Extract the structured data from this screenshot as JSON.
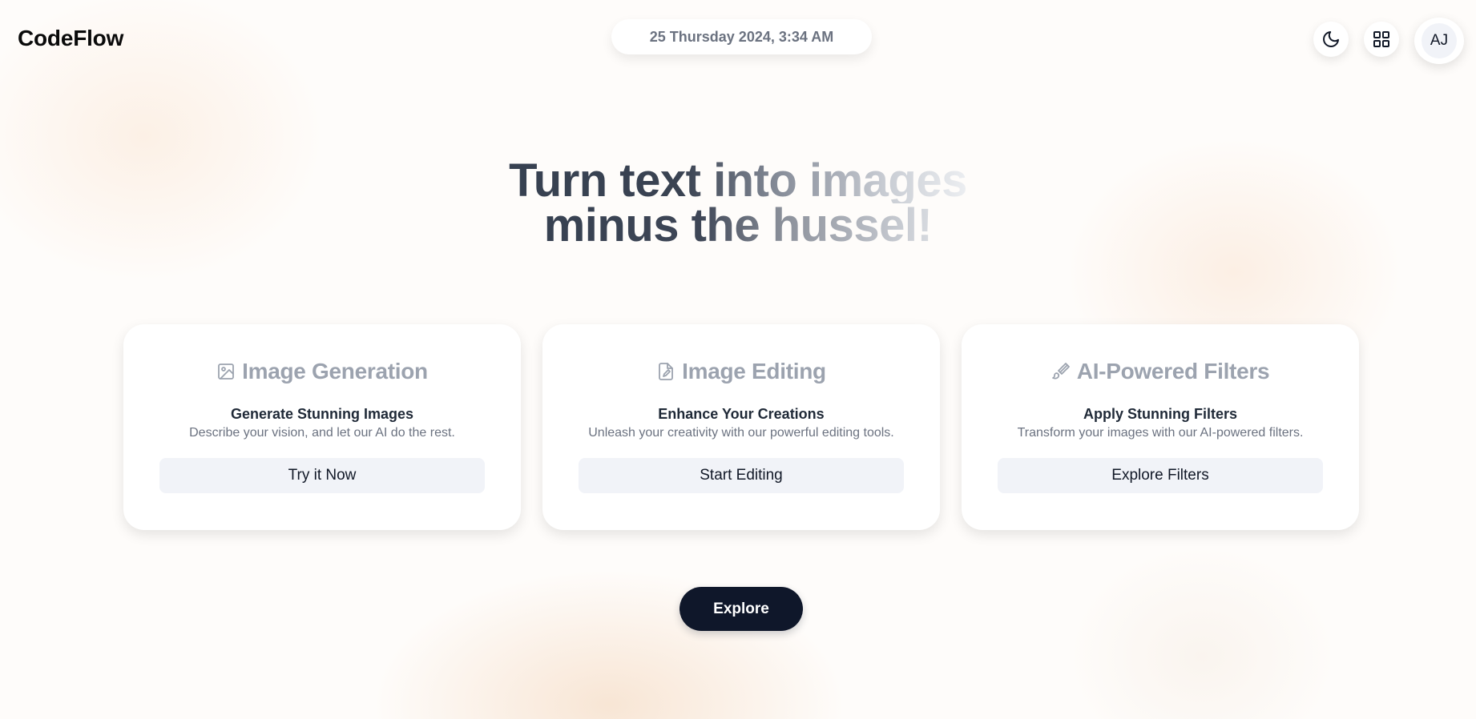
{
  "header": {
    "brand": "CodeFlow",
    "datetime": "25 Thursday 2024, 3:34 AM",
    "avatar_initials": "AJ",
    "icons": {
      "theme": "moon-icon",
      "apps": "grid-icon"
    }
  },
  "hero": {
    "line1": "Turn text into images",
    "line2": "minus the hussel!"
  },
  "cards": [
    {
      "icon": "image-icon",
      "title": "Image Generation",
      "subtitle": "Generate Stunning Images",
      "description": "Describe your vision, and let our AI do the rest.",
      "button": "Try it Now"
    },
    {
      "icon": "file-edit-icon",
      "title": "Image Editing",
      "subtitle": "Enhance Your Creations",
      "description": "Unleash your creativity with our powerful editing tools.",
      "button": "Start Editing"
    },
    {
      "icon": "brush-icon",
      "title": "AI-Powered Filters",
      "subtitle": "Apply Stunning Filters",
      "description": "Transform your images with our AI-powered filters.",
      "button": "Explore Filters"
    }
  ],
  "cta": {
    "label": "Explore"
  },
  "colors": {
    "primary": "#0f172a",
    "muted_title": "#9ca3af",
    "button_bg": "#f1f3f8",
    "hero_text": "#374151"
  }
}
